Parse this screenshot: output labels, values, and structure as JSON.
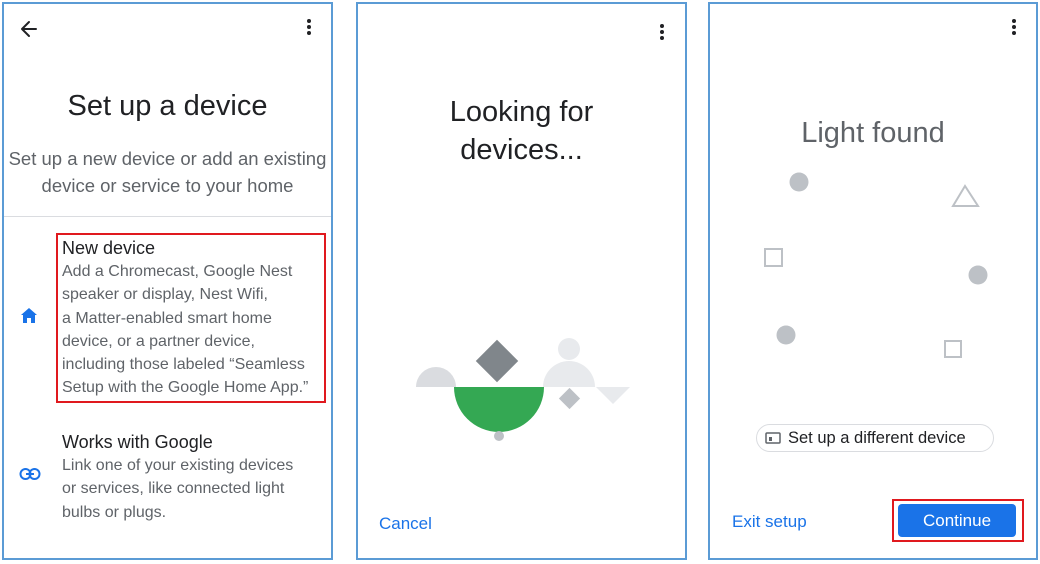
{
  "panel1": {
    "title": "Set up a device",
    "subtitle_line1": "Set up a new device or add an existing",
    "subtitle_line2": "device or service to your home",
    "options": [
      {
        "title": "New device",
        "desc_lines": [
          "Add a Chromecast, Google Nest",
          "speaker or display, Nest Wifi,",
          "a Matter-enabled smart home",
          "device, or a partner device,",
          "including those labeled “Seamless",
          "Setup with the Google Home App.”"
        ],
        "icon": "home-icon"
      },
      {
        "title": "Works with Google",
        "desc_lines": [
          "Link one of your existing devices",
          "or services, like connected light",
          "bulbs or plugs."
        ],
        "icon": "link-icon"
      }
    ]
  },
  "panel2": {
    "title_line1": "Looking for",
    "title_line2": "devices...",
    "cancel_label": "Cancel"
  },
  "panel3": {
    "title": "Light found",
    "chip_label": "Set up a different device",
    "exit_label": "Exit setup",
    "continue_label": "Continue"
  },
  "colors": {
    "accent": "#1a73e8",
    "green": "#34a853",
    "highlight": "#e0191e",
    "panel_border": "#5b9bd5"
  }
}
